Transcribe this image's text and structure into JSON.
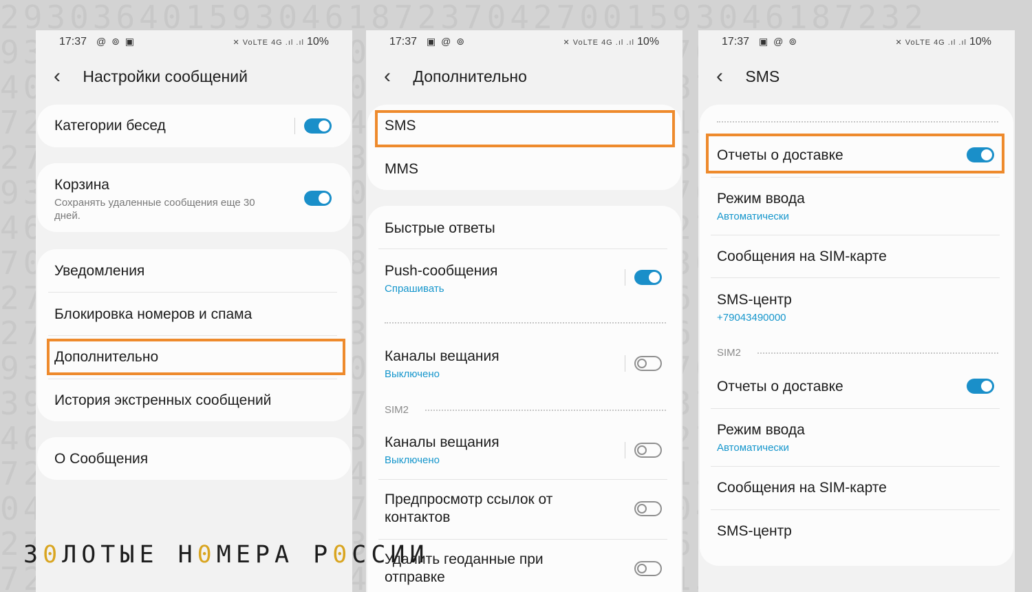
{
  "screen1": {
    "status": {
      "time": "17:37",
      "icons": "@ ⊚ ▣",
      "battery": "10%"
    },
    "header": {
      "title": "Настройки сообщений"
    },
    "items": {
      "categories": "Категории бесед",
      "trash": "Корзина",
      "trash_sub": "Сохранять удаленные сообщения еще 30 дней.",
      "notifications": "Уведомления",
      "block": "Блокировка номеров и спама",
      "advanced": "Дополнительно",
      "emergency": "История экстренных сообщений",
      "about": "О Сообщения"
    },
    "toggles": {
      "categories": true,
      "trash": true
    }
  },
  "screen2": {
    "status": {
      "time": "17:37",
      "icons": "▣ @ ⊚",
      "battery": "10%"
    },
    "header": {
      "title": "Дополнительно"
    },
    "items": {
      "sms": "SMS",
      "mms": "MMS",
      "quick": "Быстрые ответы",
      "push": "Push-сообщения",
      "push_sub": "Спрашивать",
      "cb1": "Каналы вещания",
      "cb1_sub": "Выключено",
      "sim2": "SIM2",
      "cb2": "Каналы вещания",
      "cb2_sub": "Выключено",
      "preview": "Предпросмотр ссылок от контактов",
      "geo": "Удалить геоданные при отправке"
    },
    "toggles": {
      "push": true,
      "cb1": false,
      "cb2": false,
      "preview": false,
      "geo": false
    }
  },
  "screen3": {
    "status": {
      "time": "17:37",
      "icons": "▣ @ ⊚",
      "battery": "10%"
    },
    "header": {
      "title": "SMS"
    },
    "items": {
      "delivery1": "Отчеты о доставке",
      "input1": "Режим ввода",
      "input1_sub": "Автоматически",
      "simmsg1": "Сообщения на SIM-карте",
      "center1": "SMS-центр",
      "center1_sub": "+79043490000",
      "sim2": "SIM2",
      "delivery2": "Отчеты о доставке",
      "input2": "Режим ввода",
      "input2_sub": "Автоматически",
      "simmsg2": "Сообщения на SIM-карте",
      "center2": "SMS-центр"
    },
    "toggles": {
      "delivery1": true,
      "delivery2": true
    }
  },
  "brand": {
    "text_before": "З",
    "zero1": "0",
    "text_mid": "ЛОТЫЕ Н",
    "zero2": "0",
    "text_mid2": "МЕРА Р",
    "zero3": "0",
    "text_end": "ССИИ"
  },
  "colors": {
    "accent": "#1a8fc9",
    "highlight": "#ee8a2c",
    "brand_zero": "#d9a520"
  }
}
